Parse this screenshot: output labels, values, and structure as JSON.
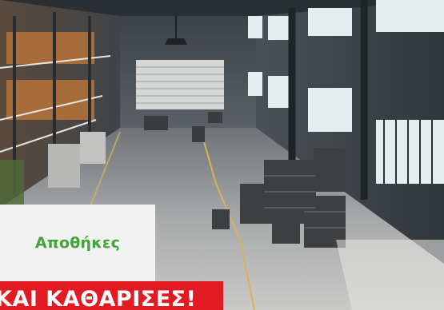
{
  "hero": {
    "image_alt": "Warehouse interior with pallets of goods"
  },
  "category_card": {
    "label": "Αποθήκες",
    "color": "#43a43c"
  },
  "banner": {
    "text": "ΚΑΙ ΚΑΘΑΡΙΣΕΣ!",
    "color": "#e21b22"
  }
}
